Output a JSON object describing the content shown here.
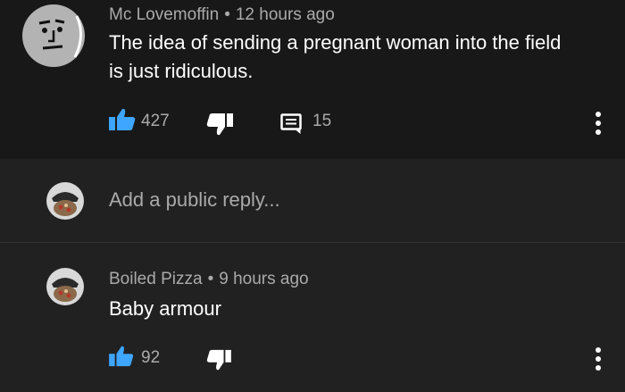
{
  "comment1": {
    "author": "Mc Lovemoffin",
    "time": "12 hours ago",
    "text_line1": "The idea of sending a pregnant woman into the field",
    "text_line2": "is just ridiculous.",
    "likes": "427",
    "replies": "15"
  },
  "reply_box": {
    "placeholder": "Add a public reply..."
  },
  "comment2": {
    "author": "Boiled Pizza",
    "time": "9 hours ago",
    "text": "Baby armour",
    "likes": "92"
  },
  "icons": {
    "like": "thumbs-up-icon",
    "dislike": "thumbs-down-icon",
    "reply": "comment-icon",
    "more": "more-vertical-icon"
  },
  "colors": {
    "like_active": "#3ea6ff",
    "secondary_text": "#aaaaaa",
    "background_top": "#181818",
    "background_bottom": "#212121"
  }
}
